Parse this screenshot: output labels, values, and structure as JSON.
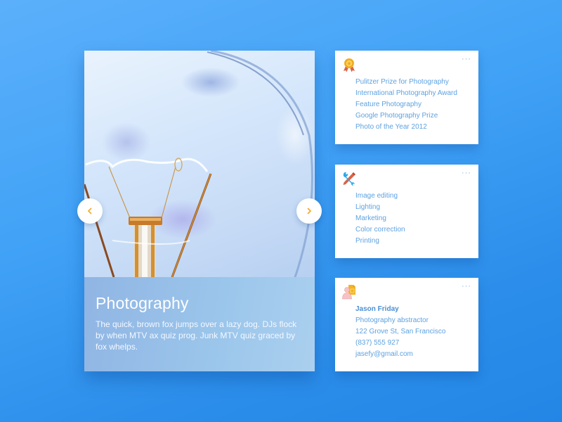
{
  "hero": {
    "title": "Photography",
    "description": "The quick, brown fox jumps over a lazy dog. DJs flock by when MTV ax quiz prog. Junk MTV quiz graced by fox whelps.",
    "image": "lightbulb-photo",
    "prev_icon": "chevron-left-icon",
    "next_icon": "chevron-right-icon",
    "accent": "#f5a623"
  },
  "cards": [
    {
      "icon": "award-medal-icon",
      "more": "···",
      "items": [
        "Pulitzer Prize for Photography",
        "International Photography Award",
        "Feature Photography",
        "Google Photography Prize",
        "Photo of the Year 2012"
      ]
    },
    {
      "icon": "tools-icon",
      "more": "···",
      "items": [
        "Image editing",
        "Lighting",
        "Marketing",
        "Color correction",
        "Printing"
      ]
    },
    {
      "icon": "contact-profile-icon",
      "more": "···",
      "name": "Jason Friday",
      "role": "Photography abstractor",
      "address": "122 Grove St, San Francisco",
      "phone": "(837) 555 927",
      "email": "jasefy@gmail.com"
    }
  ],
  "colors": {
    "background": "#41a2f6",
    "link_text": "#5ea2e0",
    "card_bg": "#ffffff"
  }
}
